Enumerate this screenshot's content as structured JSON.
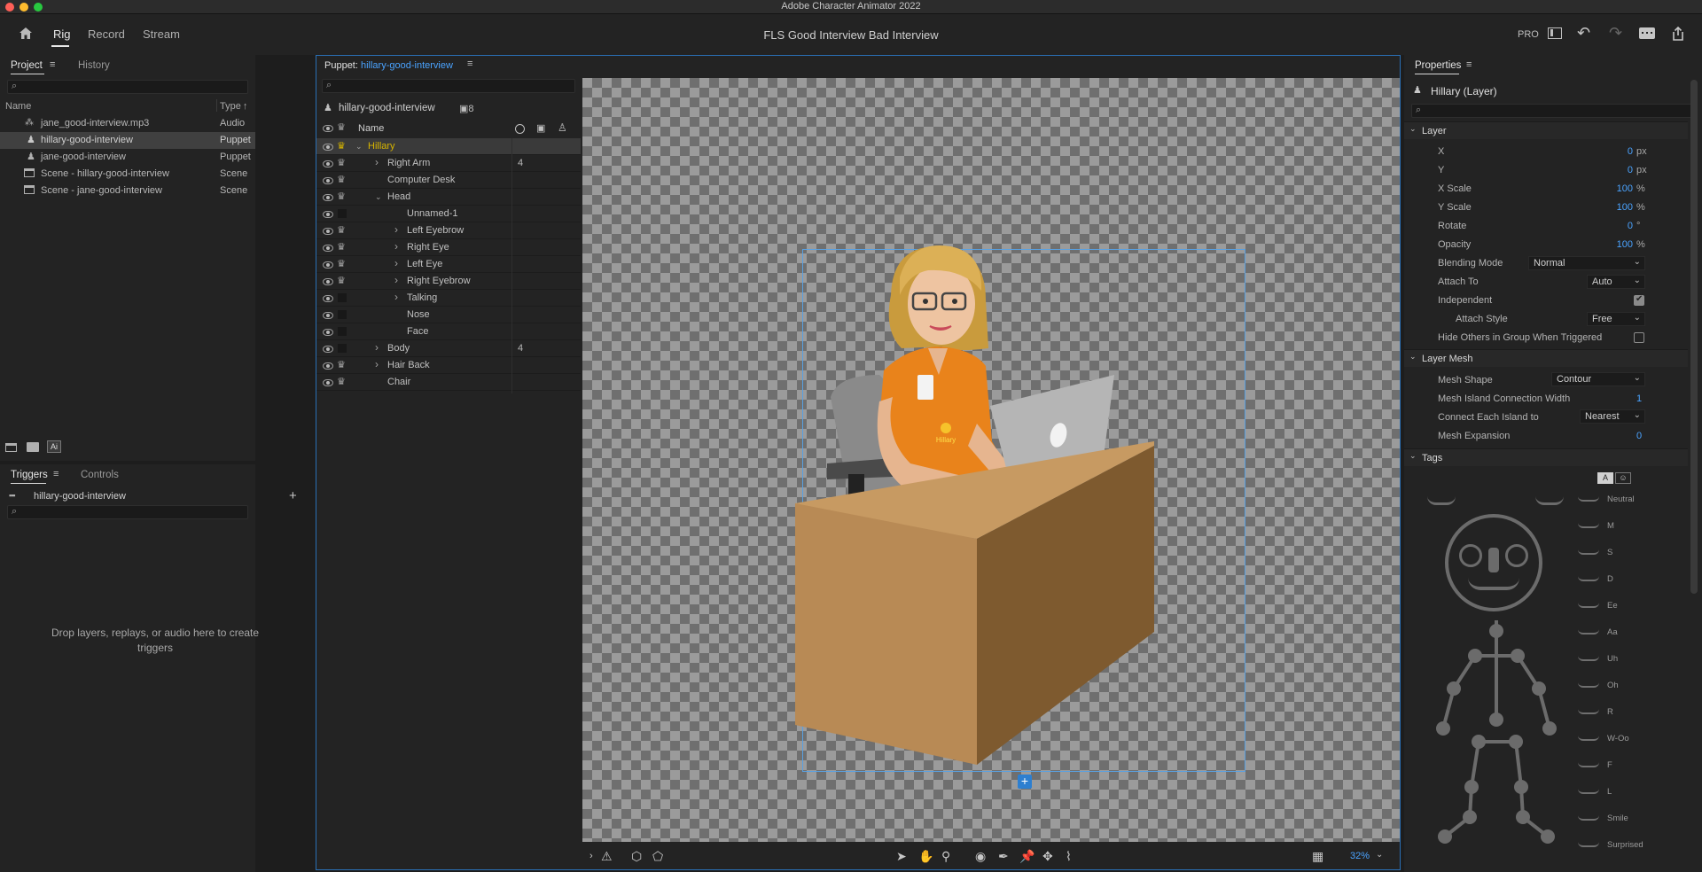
{
  "app": {
    "title": "Adobe Character Animator 2022"
  },
  "toolbar": {
    "home_icon": "home-icon",
    "tabs": [
      "Rig",
      "Record",
      "Stream"
    ],
    "document_title": "FLS Good Interview Bad Interview",
    "pro_label": "PRO"
  },
  "project_panel": {
    "tabs": [
      "Project",
      "History"
    ],
    "columns": {
      "name": "Name",
      "type": "Type"
    },
    "items": [
      {
        "name": "jane_good-interview.mp3",
        "type": "Audio"
      },
      {
        "name": "hillary-good-interview",
        "type": "Puppet"
      },
      {
        "name": "jane-good-interview",
        "type": "Puppet"
      },
      {
        "name": "Scene - hillary-good-interview",
        "type": "Scene"
      },
      {
        "name": "Scene - jane-good-interview",
        "type": "Scene"
      }
    ],
    "selected_index": 1,
    "bottom_badge": "Ai"
  },
  "triggers_panel": {
    "tabs": [
      "Triggers",
      "Controls"
    ],
    "puppet": "hillary-good-interview",
    "empty_message": "Drop layers, replays, or audio here to create triggers"
  },
  "puppet_panel": {
    "tab_prefix": "Puppet:",
    "tab_name": "hillary-good-interview",
    "puppet_name": "hillary-good-interview",
    "count": "8",
    "column_name": "Name",
    "layers": [
      {
        "name": "Hillary",
        "depth": 0,
        "expanded": true,
        "selected": true,
        "crown": true,
        "count": ""
      },
      {
        "name": "Right Arm",
        "depth": 1,
        "arrow": "collapsed",
        "crown": true,
        "count": "4"
      },
      {
        "name": "Computer Desk",
        "depth": 1,
        "crown": true,
        "count": ""
      },
      {
        "name": "Head",
        "depth": 1,
        "arrow": "expanded",
        "crown": true,
        "count": ""
      },
      {
        "name": "Unnamed-1",
        "depth": 2,
        "crown": false,
        "count": ""
      },
      {
        "name": "Left Eyebrow",
        "depth": 2,
        "arrow": "collapsed",
        "crown": true,
        "count": ""
      },
      {
        "name": "Right Eye",
        "depth": 2,
        "arrow": "collapsed",
        "crown": true,
        "count": ""
      },
      {
        "name": "Left Eye",
        "depth": 2,
        "arrow": "collapsed",
        "crown": true,
        "count": ""
      },
      {
        "name": "Right Eyebrow",
        "depth": 2,
        "arrow": "collapsed",
        "crown": true,
        "count": ""
      },
      {
        "name": "Talking",
        "depth": 2,
        "arrow": "collapsed",
        "crown": false,
        "count": ""
      },
      {
        "name": "Nose",
        "depth": 2,
        "crown": false,
        "count": ""
      },
      {
        "name": "Face",
        "depth": 2,
        "crown": false,
        "count": ""
      },
      {
        "name": "Body",
        "depth": 1,
        "arrow": "collapsed",
        "crown": false,
        "count": "4"
      },
      {
        "name": "Hair Back",
        "depth": 1,
        "arrow": "collapsed",
        "crown": true,
        "count": ""
      },
      {
        "name": "Chair",
        "depth": 1,
        "crown": true,
        "count": ""
      }
    ]
  },
  "canvas": {
    "badge_text": "Hillary",
    "zoom": "32%"
  },
  "properties_panel": {
    "title": "Properties",
    "layer_title": "Hillary (Layer)",
    "layer_section": "Layer",
    "layer_props": [
      {
        "label": "X",
        "value": "0",
        "unit": "px"
      },
      {
        "label": "Y",
        "value": "0",
        "unit": "px"
      },
      {
        "label": "X Scale",
        "value": "100",
        "unit": "%"
      },
      {
        "label": "Y Scale",
        "value": "100",
        "unit": "%"
      },
      {
        "label": "Rotate",
        "value": "0",
        "unit": "°"
      },
      {
        "label": "Opacity",
        "value": "100",
        "unit": "%"
      }
    ],
    "blending_mode": {
      "label": "Blending Mode",
      "value": "Normal"
    },
    "attach_to": {
      "label": "Attach To",
      "value": "Auto"
    },
    "independent": {
      "label": "Independent",
      "checked": true
    },
    "attach_style": {
      "label": "Attach Style",
      "value": "Free"
    },
    "hide_others": {
      "label": "Hide Others in Group When Triggered",
      "checked": false
    },
    "mesh_section": "Layer Mesh",
    "mesh_shape": {
      "label": "Mesh Shape",
      "value": "Contour"
    },
    "island_width": {
      "label": "Mesh Island Connection Width",
      "value": "1"
    },
    "connect_each": {
      "label": "Connect Each Island to",
      "value": "Nearest"
    },
    "mesh_expansion": {
      "label": "Mesh Expansion",
      "value": "0"
    },
    "tags_section": "Tags",
    "tags_mode_label": "A",
    "visemes": [
      "Neutral",
      "M",
      "S",
      "D",
      "Ee",
      "Aa",
      "Uh",
      "Oh",
      "R",
      "W-Oo",
      "F",
      "L",
      "Smile",
      "Surprised"
    ]
  },
  "colors": {
    "accent": "#4aa3ff",
    "selection": "#3a3a3a",
    "crown_active": "#d6b400",
    "desk_top": "#c79a62",
    "desk_front": "#b88a55",
    "desk_side": "#7e5a2f",
    "shirt": "#e9831b"
  }
}
